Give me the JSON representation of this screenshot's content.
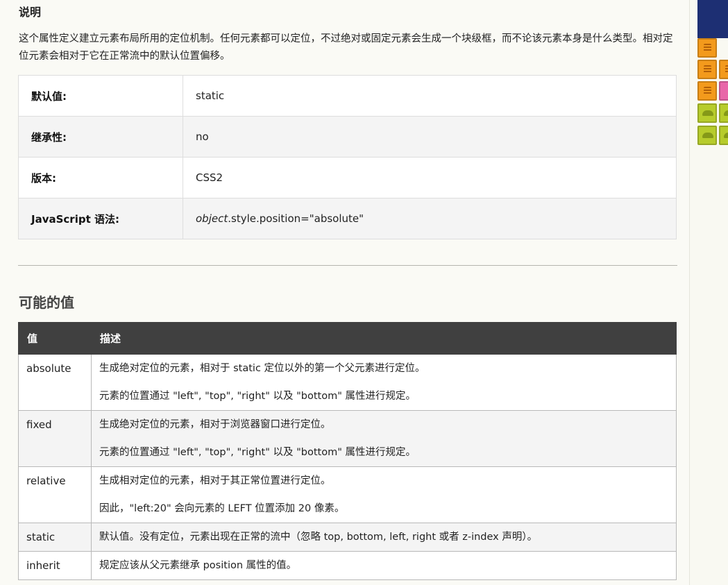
{
  "description_heading": "说明",
  "description_text": "这个属性定义建立元素布局所用的定位机制。任何元素都可以定位，不过绝对或固定元素会生成一个块级框，而不论该元素本身是什么类型。相对定位元素会相对于它在正常流中的默认位置偏移。",
  "properties": [
    {
      "label": "默认值:",
      "value": "static"
    },
    {
      "label": "继承性:",
      "value": "no"
    },
    {
      "label": "版本:",
      "value": "CSS2"
    },
    {
      "label": "JavaScript 语法:",
      "value_italic": "object",
      "value": ".style.position=\"absolute\""
    }
  ],
  "values_heading": "可能的值",
  "values_table": {
    "headers": [
      "值",
      "描述"
    ],
    "rows": [
      {
        "value": "absolute",
        "lines": [
          "生成绝对定位的元素，相对于 static 定位以外的第一个父元素进行定位。",
          "元素的位置通过 \"left\", \"top\", \"right\" 以及 \"bottom\" 属性进行规定。"
        ]
      },
      {
        "value": "fixed",
        "lines": [
          "生成绝对定位的元素，相对于浏览器窗口进行定位。",
          "元素的位置通过 \"left\", \"top\", \"right\" 以及 \"bottom\" 属性进行规定。"
        ]
      },
      {
        "value": "relative",
        "lines": [
          "生成相对定位的元素，相对于其正常位置进行定位。",
          "因此，\"left:20\" 会向元素的 LEFT 位置添加 20 像素。"
        ]
      },
      {
        "value": "static",
        "lines": [
          "默认值。没有定位，元素出现在正常的流中（忽略 top, bottom, left, right 或者 z-index 声明）。"
        ]
      },
      {
        "value": "inherit",
        "lines": [
          "规定应该从父元素继承 position 属性的值。"
        ]
      }
    ]
  },
  "colors": {
    "page_background": "#fafaf5",
    "table_header": "#404040",
    "ad_sky": "#1d2f73",
    "block_orange": "#f39a1c",
    "block_pink": "#e867a9",
    "block_green": "#b7cc2c"
  }
}
